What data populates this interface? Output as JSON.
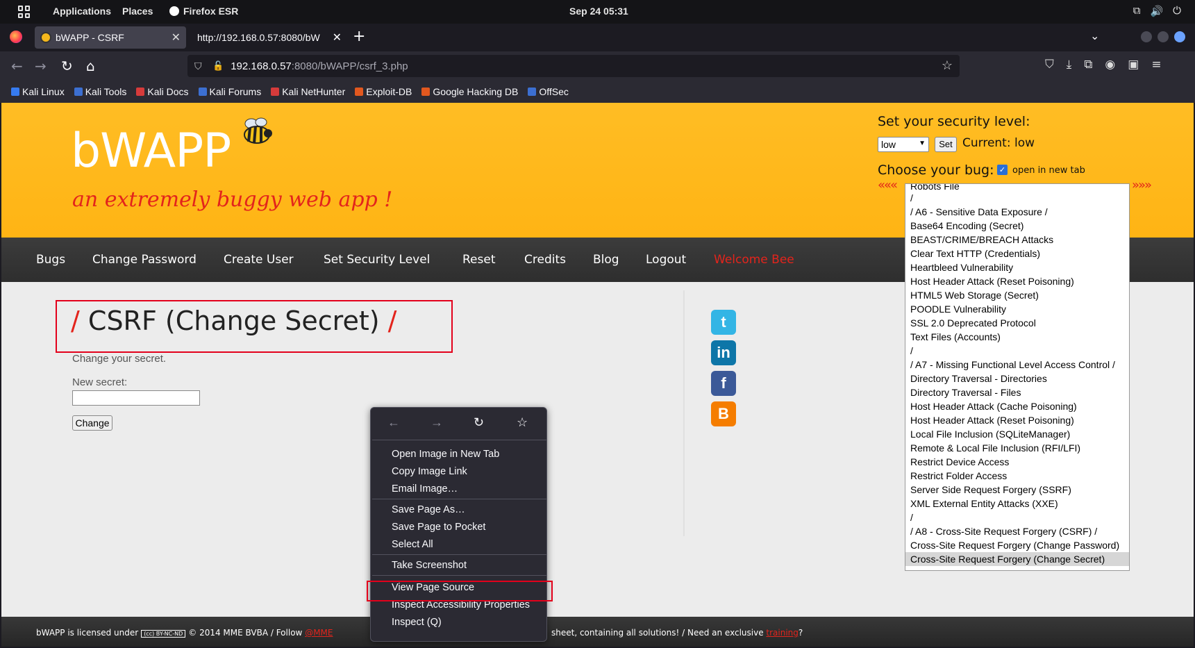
{
  "os": {
    "applications": "Applications",
    "places": "Places",
    "active_app": "Firefox ESR",
    "clock": "Sep 24  05:31"
  },
  "browser": {
    "tabs": [
      {
        "title": "bWAPP - CSRF",
        "active": true
      },
      {
        "title": "http://192.168.0.57:8080/bW",
        "active": false
      }
    ],
    "url_host": "192.168.0.57",
    "url_path": ":8080/bWAPP/csrf_3.php",
    "bookmarks": [
      "Kali Linux",
      "Kali Tools",
      "Kali Docs",
      "Kali Forums",
      "Kali NetHunter",
      "Exploit-DB",
      "Google Hacking DB",
      "OffSec"
    ]
  },
  "page": {
    "logo": "bWAPP",
    "tagline": "an extremely buggy web app !",
    "security": {
      "title": "Set your security level:",
      "selected": "low",
      "set_label": "Set",
      "current": "Current: low"
    },
    "choose_bug": "Choose your bug:",
    "open_new_tab": "open in new tab",
    "arrows_left": "«««",
    "arrows_right": "»»»",
    "menu": [
      "Bugs",
      "Change Password",
      "Create User",
      "Set Security Level",
      "Reset",
      "Credits",
      "Blog",
      "Logout",
      "Welcome Bee"
    ],
    "title_slash": "/",
    "title_text": "CSRF (Change Secret)",
    "intro": "Change your secret.",
    "new_secret_label": "New secret:",
    "change_button": "Change",
    "social": [
      "t",
      "in",
      "f",
      "B"
    ],
    "footer": {
      "licensed": "bWAPP is licensed under",
      "cc": "(cc) BY-NC-ND",
      "copy": "© 2014 MME BVBA / Follow",
      "follow_link": "@MME",
      "sheet": "sheet, containing all solutions! / Need an exclusive",
      "training": "training",
      "q": "?"
    },
    "bug_options": [
      "Robots File",
      "/",
      "/ A6 - Sensitive Data Exposure /",
      "Base64 Encoding (Secret)",
      "BEAST/CRIME/BREACH Attacks",
      "Clear Text HTTP (Credentials)",
      "Heartbleed Vulnerability",
      "Host Header Attack (Reset Poisoning)",
      "HTML5 Web Storage (Secret)",
      "POODLE Vulnerability",
      "SSL 2.0 Deprecated Protocol",
      "Text Files (Accounts)",
      "/",
      "/ A7 - Missing Functional Level Access Control /",
      "Directory Traversal - Directories",
      "Directory Traversal - Files",
      "Host Header Attack (Cache Poisoning)",
      "Host Header Attack (Reset Poisoning)",
      "Local File Inclusion (SQLiteManager)",
      "Remote & Local File Inclusion (RFI/LFI)",
      "Restrict Device Access",
      "Restrict Folder Access",
      "Server Side Request Forgery (SSRF)",
      "XML External Entity Attacks (XXE)",
      "/",
      "/ A8 - Cross-Site Request Forgery (CSRF) /",
      "Cross-Site Request Forgery (Change Password)",
      "Cross-Site Request Forgery (Change Secret)"
    ],
    "selected_bug": "Cross-Site Request Forgery (Change Secret)"
  },
  "context_menu": {
    "items": [
      "Open Image in New Tab",
      "Copy Image Link",
      "Email Image…",
      "Save Page As…",
      "Save Page to Pocket",
      "Select All",
      "Take Screenshot",
      "View Page Source",
      "Inspect Accessibility Properties",
      "Inspect (Q)"
    ]
  },
  "colors": {
    "accent_red": "#e3241c",
    "header_yellow": "#ffb81c",
    "highlight_box": "#e3001b"
  }
}
